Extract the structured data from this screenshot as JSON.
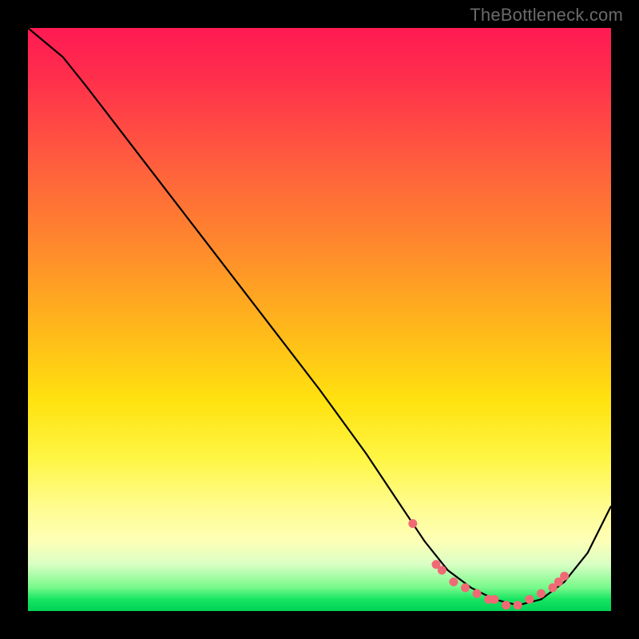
{
  "watermark": "TheBottleneck.com",
  "chart_data": {
    "type": "line",
    "title": "",
    "xlabel": "",
    "ylabel": "",
    "xlim": [
      0,
      100
    ],
    "ylim": [
      0,
      100
    ],
    "series": [
      {
        "name": "curve",
        "x": [
          0,
          6,
          10,
          20,
          30,
          40,
          50,
          58,
          64,
          68,
          72,
          76,
          80,
          84,
          88,
          92,
          96,
          100
        ],
        "values": [
          100,
          95,
          90,
          77,
          64,
          51,
          38,
          27,
          18,
          12,
          7,
          4,
          2,
          1,
          2,
          5,
          10,
          18
        ]
      }
    ],
    "markers": {
      "name": "dots",
      "color": "#f06a76",
      "x": [
        66,
        70,
        71,
        73,
        75,
        77,
        79,
        80,
        82,
        84,
        86,
        88,
        90,
        91,
        92
      ],
      "values": [
        15,
        8,
        7,
        5,
        4,
        3,
        2,
        2,
        1,
        1,
        2,
        3,
        4,
        5,
        6
      ]
    }
  },
  "colors": {
    "curve": "#000000",
    "marker": "#f06a76"
  }
}
